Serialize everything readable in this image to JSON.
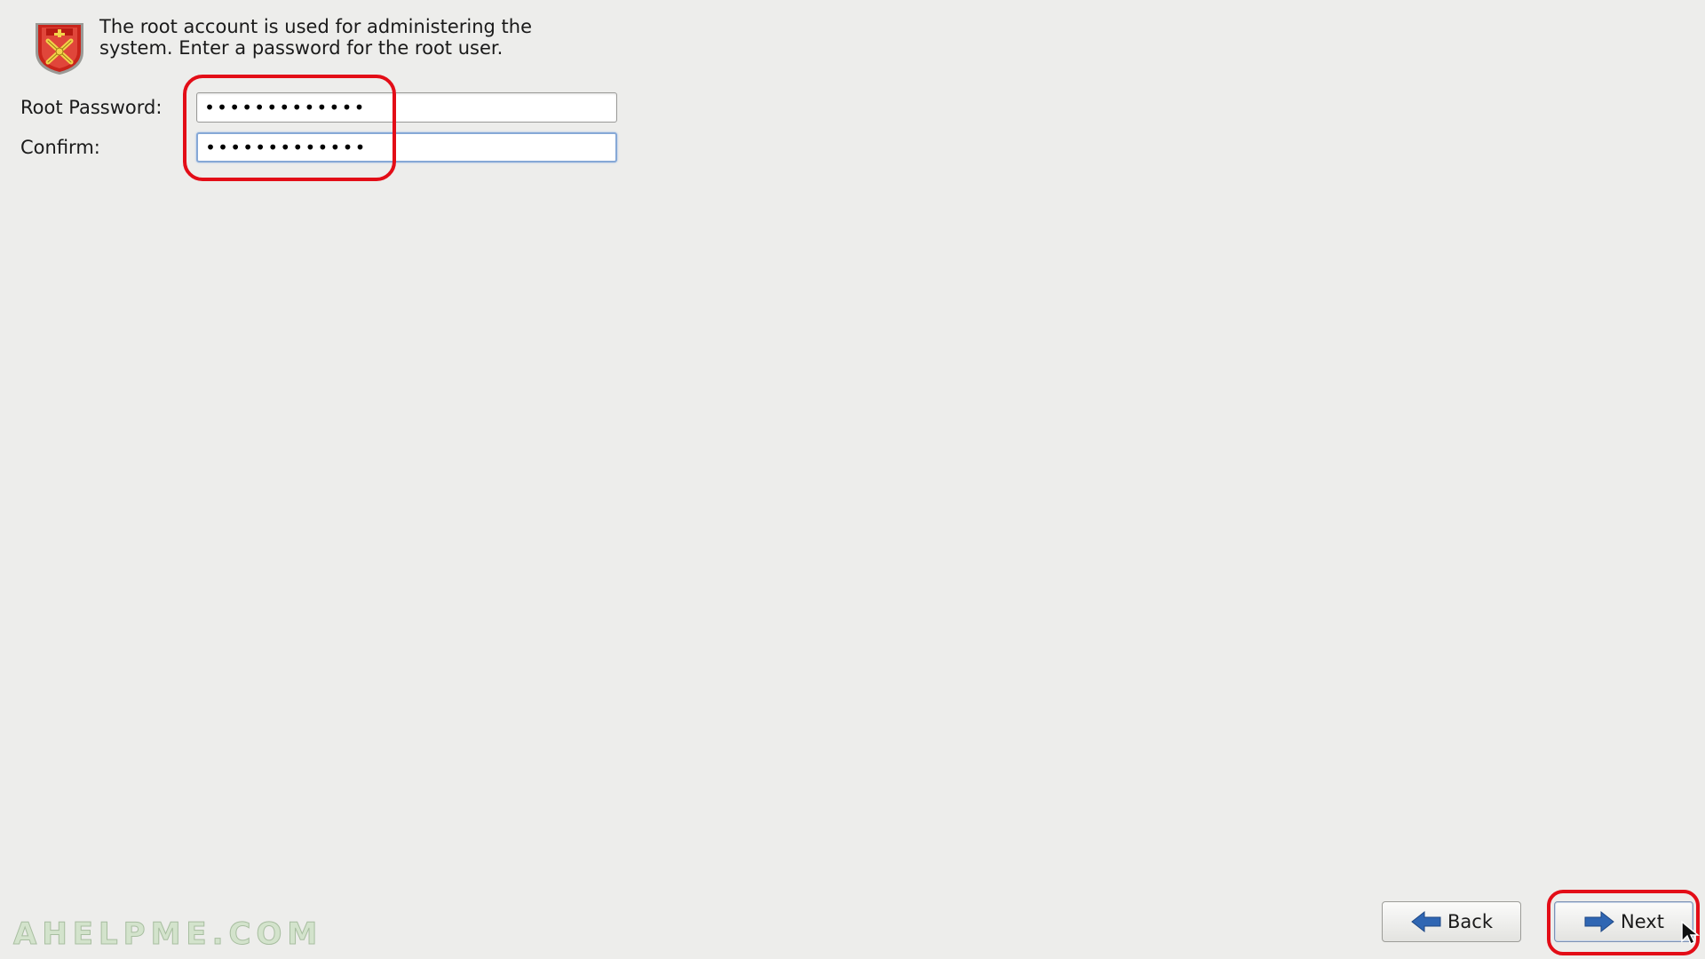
{
  "header": {
    "icon": "shield-icon",
    "description": "The root account is used for administering the system.  Enter a password for the root user."
  },
  "form": {
    "root_password_label": "Root Password:",
    "root_password_value": "•••••••••••••",
    "confirm_label": "Confirm:",
    "confirm_value": "•••••••••••••"
  },
  "buttons": {
    "back_label": "Back",
    "back_icon": "arrow-left-icon",
    "next_label": "Next",
    "next_icon": "arrow-right-icon"
  },
  "watermark": "AHELPME.COM",
  "colors": {
    "background": "#ededeb",
    "highlight": "#e30d17",
    "arrow_blue": "#2f66b3"
  }
}
